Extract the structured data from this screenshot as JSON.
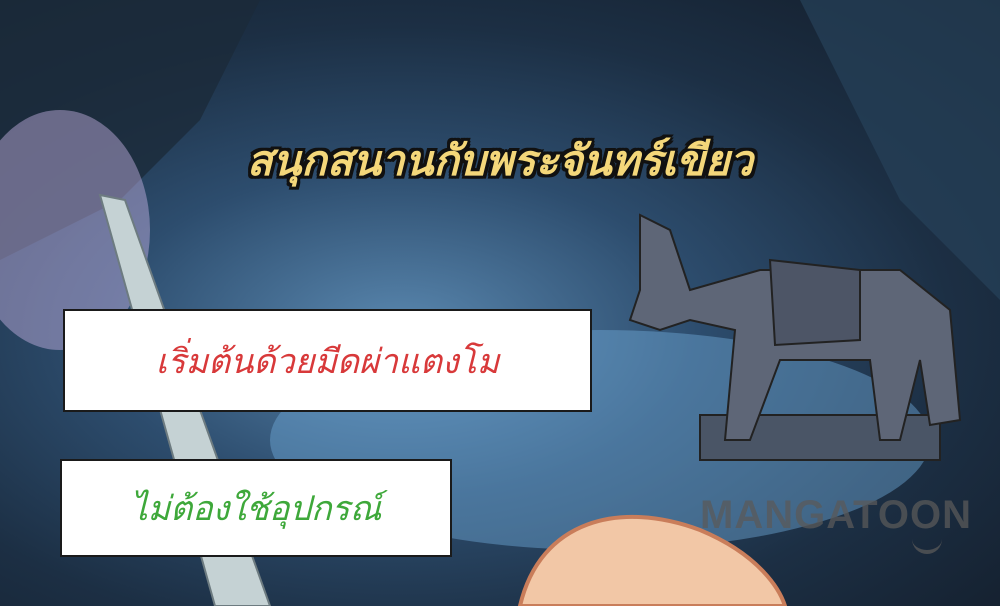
{
  "panel": {
    "title": "สนุกสนานกับพระจันทร์เขียว",
    "caption_1": "เริ่มต้นด้วยมีดผ่าแตงโม",
    "caption_2": "ไม่ต้องใช้อุปกรณ์",
    "watermark": "MANGATOON"
  },
  "colors": {
    "title": "#f4d77a",
    "caption_1": "#d8393a",
    "caption_2": "#3ea83a"
  }
}
